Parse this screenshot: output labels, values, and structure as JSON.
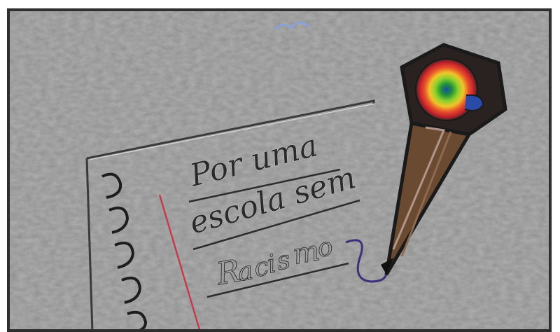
{
  "artwork": {
    "line1": "Por uma",
    "line2": "escola sem",
    "word_letters": [
      "R",
      "a",
      "c",
      "i",
      "s",
      "m",
      "o"
    ],
    "word_letter_colors": [
      "#d03a2b",
      "#e8a42c",
      "#2f9a3c",
      "#3a5fc8",
      "#a03aa8",
      "#2a8f8a",
      "#d34f8a"
    ]
  },
  "colors": {
    "background": "#8f8f8f",
    "frame": "#2e2e2e",
    "margin_line": "#c53a4a",
    "pencil_wood": "#6b4a32",
    "pencil_outline": "#1a1a1a"
  }
}
